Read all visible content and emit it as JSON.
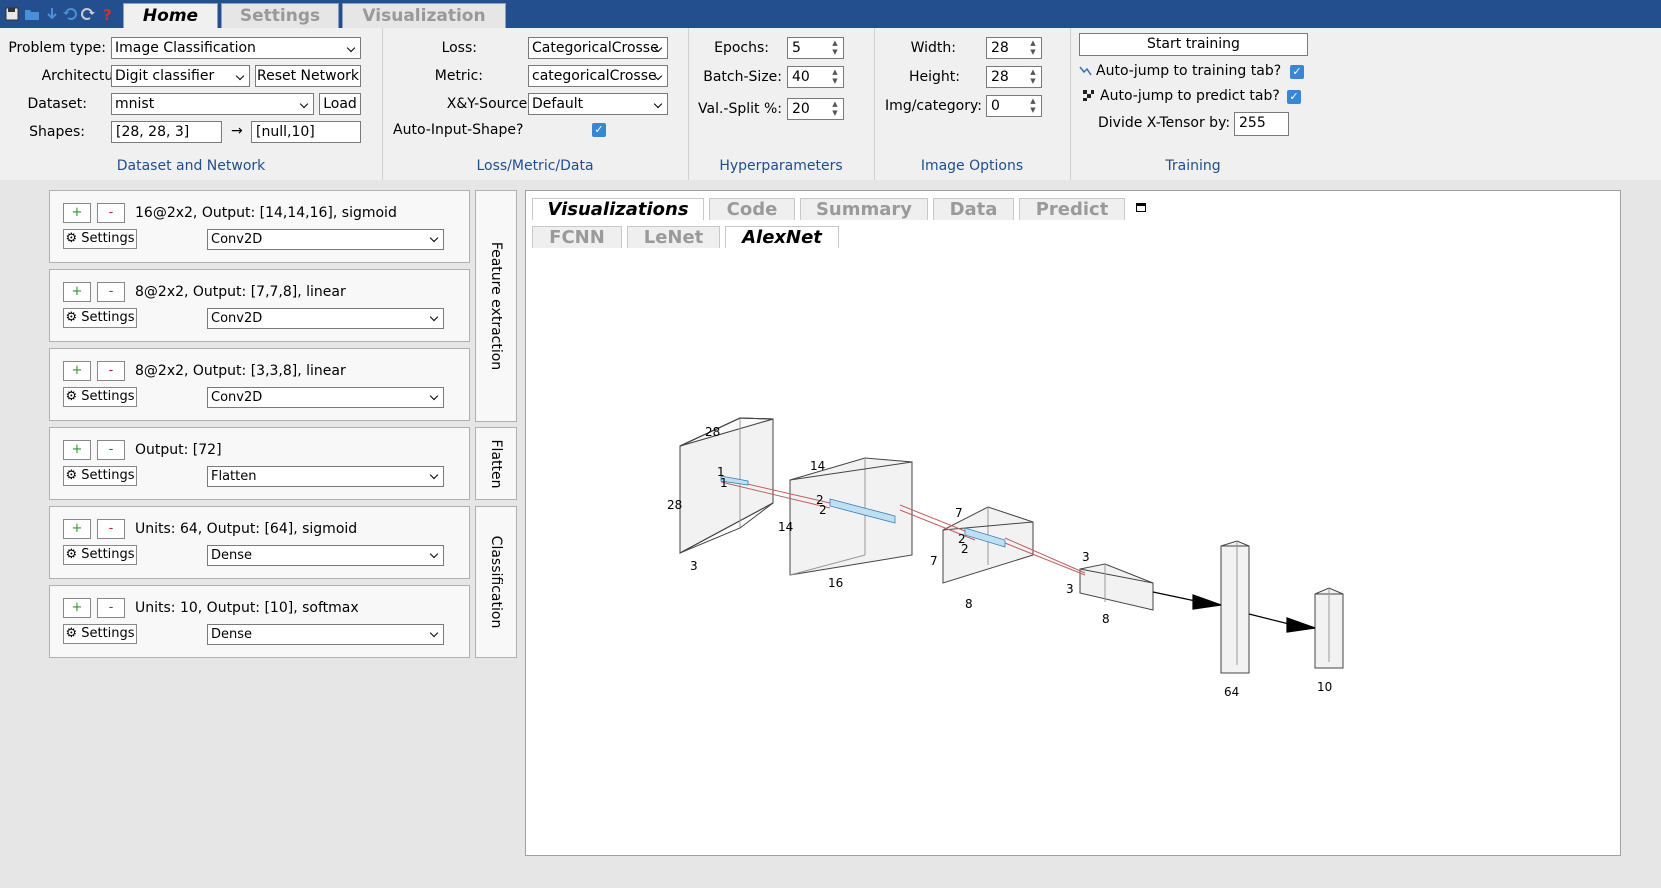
{
  "toolbar": {
    "icons": [
      "save-icon",
      "open-folder-icon",
      "download-icon",
      "undo-icon",
      "redo-icon",
      "help-icon"
    ]
  },
  "main_tabs": [
    {
      "label": "Home",
      "active": true
    },
    {
      "label": "Settings",
      "active": false
    },
    {
      "label": "Visualization",
      "active": false
    }
  ],
  "dataset_network": {
    "problem_type_label": "Problem type:",
    "problem_type": "Image Classification",
    "architecture_label": "Architecture:",
    "architecture": "Digit classifier",
    "reset_label": "Reset Network",
    "dataset_label": "Dataset:",
    "dataset": "mnist",
    "load_label": "Load",
    "shapes_label": "Shapes:",
    "input_shape": "[28, 28, 3]",
    "arrow": "→",
    "output_shape": "[null,10]",
    "group_label": "Dataset and Network"
  },
  "loss_metric": {
    "loss_label": "Loss:",
    "loss": "CategoricalCrosse",
    "metric_label": "Metric:",
    "metric": "categoricalCrosse",
    "source_label": "X&Y-Source:",
    "source": "Default",
    "auto_shape_label": "Auto-Input-Shape?",
    "group_label": "Loss/Metric/Data"
  },
  "hyperparameters": {
    "epochs_label": "Epochs:",
    "epochs": "5",
    "batch_label": "Batch-Size:",
    "batch": "40",
    "split_label": "Val.-Split %:",
    "split": "20",
    "group_label": "Hyperparameters"
  },
  "image_options": {
    "width_label": "Width:",
    "width": "28",
    "height_label": "Height:",
    "height": "28",
    "img_label": "Img/category:",
    "img": "0",
    "group_label": "Image Options"
  },
  "training": {
    "start_label": "Start training",
    "jump_train_label": "Auto-jump to training tab?",
    "jump_predict_label": "Auto-jump to predict tab?",
    "divide_label": "Divide X-Tensor by:",
    "divide": "255",
    "group_label": "Training"
  },
  "layers": [
    {
      "desc": "16@2x2,  Output:  [14,14,16], sigmoid",
      "type": "Conv2D"
    },
    {
      "desc": "8@2x2,  Output:  [7,7,8], linear",
      "type": "Conv2D"
    },
    {
      "desc": "8@2x2,  Output:  [3,3,8], linear",
      "type": "Conv2D"
    },
    {
      "desc": "Output:  [72]",
      "type": "Flatten"
    },
    {
      "desc": "Units:  64,  Output:  [64], sigmoid",
      "type": "Dense"
    },
    {
      "desc": "Units:  10,  Output:  [10], softmax",
      "type": "Dense"
    }
  ],
  "layer_buttons": {
    "plus": "+",
    "minus": "-",
    "settings": "⚙ Settings"
  },
  "sections": [
    "Feature extraction",
    "Flatten",
    "Classification"
  ],
  "viz_tabs": [
    "Visualizations",
    "Code",
    "Summary",
    "Data",
    "Predict"
  ],
  "viz_subtabs": [
    "FCNN",
    "LeNet",
    "AlexNet"
  ],
  "diagram_labels": {
    "b1": [
      "28",
      "28",
      "3",
      "1",
      "1"
    ],
    "b2": [
      "14",
      "14",
      "16",
      "2",
      "2"
    ],
    "b3": [
      "7",
      "7",
      "8",
      "2",
      "2"
    ],
    "b4": [
      "3",
      "3",
      "8"
    ],
    "d1": "64",
    "d2": "10"
  }
}
